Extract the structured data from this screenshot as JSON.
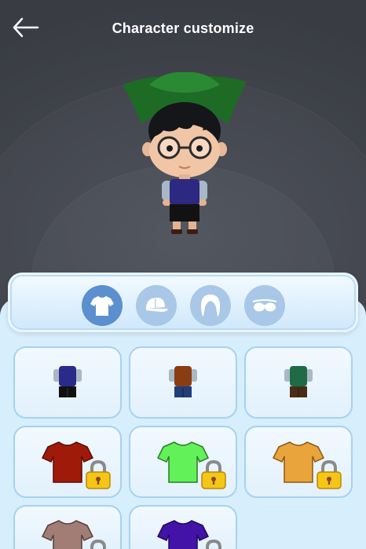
{
  "header": {
    "title": "Character customize",
    "back_icon": "arrow-left-icon"
  },
  "colors": {
    "background": "#3a3d44",
    "panel": "#d7eefd",
    "tab_active": "#5b8fcf",
    "tab_inactive": "#a9c7e6",
    "lock": "#f5c518"
  },
  "tabs": [
    {
      "icon": "tshirt-icon",
      "active": true
    },
    {
      "icon": "cap-icon",
      "active": false
    },
    {
      "icon": "hair-icon",
      "active": false
    },
    {
      "icon": "glasses-icon",
      "active": false
    }
  ],
  "outfits": [
    {
      "type": "preset-outfit",
      "vest_color": "#2a2a8a",
      "pants_color": "#111111",
      "locked": false
    },
    {
      "type": "preset-outfit",
      "vest_color": "#8a3c12",
      "pants_color": "#1f3f7a",
      "locked": false
    },
    {
      "type": "preset-outfit",
      "vest_color": "#1f6b45",
      "pants_color": "#4a2c14",
      "locked": false
    },
    {
      "type": "tshirt",
      "color": "#a01a0a",
      "locked": true
    },
    {
      "type": "tshirt",
      "color": "#63f15a",
      "locked": true
    },
    {
      "type": "tshirt",
      "color": "#eaa43c",
      "locked": true
    },
    {
      "type": "tshirt",
      "color": "#a27d76",
      "locked": true
    },
    {
      "type": "tshirt",
      "color": "#4312a6",
      "locked": true
    }
  ]
}
